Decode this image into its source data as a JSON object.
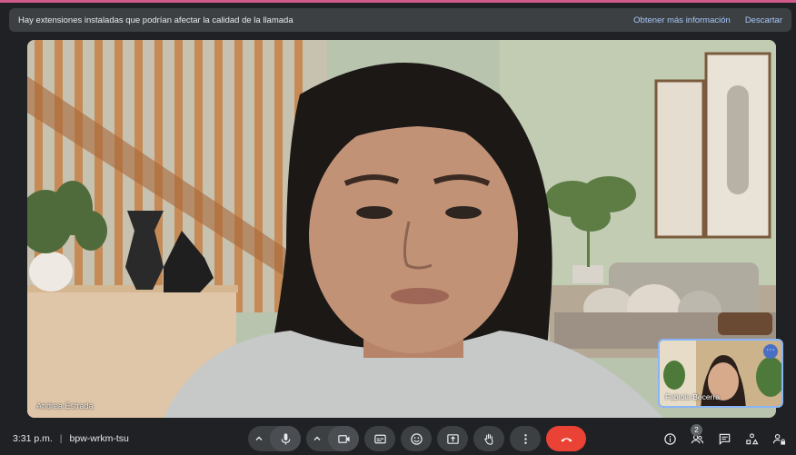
{
  "banner": {
    "message": "Hay extensiones instaladas que podrían afectar la calidad de la llamada",
    "learn_more": "Obtener más información",
    "dismiss": "Descartar"
  },
  "main_tile": {
    "participant_name": "Andrea Estrada"
  },
  "pip_tile": {
    "participant_name": "Fabiola Becerra",
    "menu_icon": "more-options-icon"
  },
  "meeting": {
    "time": "3:31 p.m.",
    "separator": "|",
    "code": "bpw-wrkm-tsu"
  },
  "controls": {
    "mic_options": "chevron-up-icon",
    "mic": "microphone-icon",
    "camera_options": "chevron-up-icon",
    "camera": "camera-icon",
    "captions": "closed-captions-icon",
    "reactions": "emoji-icon",
    "present": "present-screen-icon",
    "raise_hand": "raise-hand-icon",
    "more": "more-options-icon",
    "leave": "end-call-icon"
  },
  "right_tools": {
    "info": "info-icon",
    "people_count": "2",
    "chat": "chat-icon",
    "activities": "activities-icon",
    "host_controls": "lock-person-icon"
  },
  "colors": {
    "end_call": "#ea4335",
    "accent": "#8ab4f8",
    "banner_link": "#a8c7fa"
  }
}
